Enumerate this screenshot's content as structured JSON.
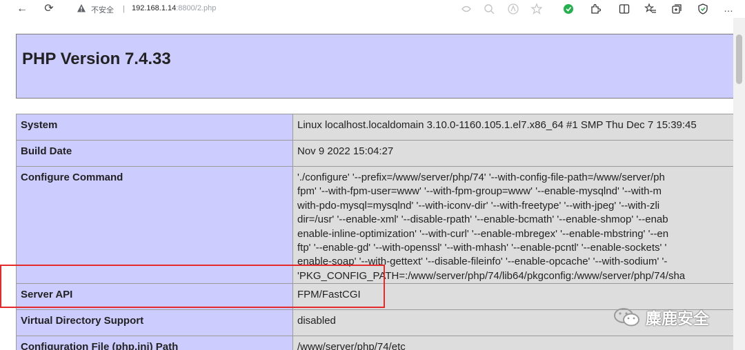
{
  "browser": {
    "back_icon": "←",
    "reload_icon": "⟳",
    "security_label": "不安全",
    "separator": "|",
    "url_host": "192.168.1.14",
    "url_rest": ":8800/2.php",
    "more_icon": "…"
  },
  "page": {
    "title": "PHP Version 7.4.33",
    "rows": {
      "system": {
        "label": "System",
        "value": "Linux localhost.localdomain 3.10.0-1160.105.1.el7.x86_64 #1 SMP Thu Dec 7 15:39:45"
      },
      "build_date": {
        "label": "Build Date",
        "value": "Nov 9 2022 15:04:27"
      },
      "configure": {
        "label": "Configure Command",
        "lines": [
          "'./configure' '--prefix=/www/server/php/74' '--with-config-file-path=/www/server/ph",
          "fpm' '--with-fpm-user=www' '--with-fpm-group=www' '--enable-mysqlnd' '--with-m",
          "with-pdo-mysql=mysqlnd' '--with-iconv-dir' '--with-freetype' '--with-jpeg' '--with-zli",
          "dir=/usr' '--enable-xml' '--disable-rpath' '--enable-bcmath' '--enable-shmop' '--enab",
          "enable-inline-optimization' '--with-curl' '--enable-mbregex' '--enable-mbstring' '--en",
          "ftp' '--enable-gd' '--with-openssl' '--with-mhash' '--enable-pcntl' '--enable-sockets' '",
          "enable-soap' '--with-gettext' '--disable-fileinfo' '--enable-opcache' '--with-sodium' '-",
          "'PKG_CONFIG_PATH=:/www/server/php/74/lib64/pkgconfig:/www/server/php/74/sha"
        ]
      },
      "server_api": {
        "label": "Server API",
        "value": "FPM/FastCGI"
      },
      "virtual_dir": {
        "label": "Virtual Directory Support",
        "value": "disabled"
      },
      "config_file": {
        "label": "Configuration File (php.ini) Path",
        "value": "/www/server/php/74/etc"
      }
    }
  },
  "watermark": {
    "text": "麋鹿安全"
  },
  "colors": {
    "header_bg": "#ccccff",
    "value_bg": "#dddddd",
    "highlight": "#e5292a"
  }
}
